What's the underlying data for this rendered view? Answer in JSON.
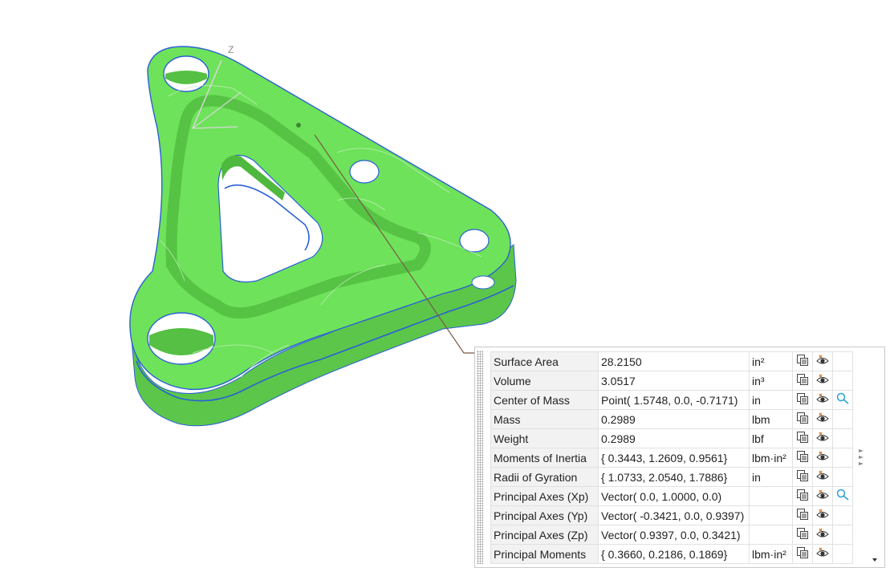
{
  "viewport": {
    "axis_label": "Z",
    "part_color": "#6ee25a",
    "edge_color": "#2a5fd6"
  },
  "properties": {
    "rows": [
      {
        "name": "Surface Area",
        "value": "28.2150",
        "unit": "in²",
        "expand": false
      },
      {
        "name": "Volume",
        "value": "3.0517",
        "unit": "in³",
        "expand": false
      },
      {
        "name": "Center of Mass",
        "value": "Point( 1.5748, 0.0, -0.7171)",
        "unit": "in",
        "expand": true
      },
      {
        "name": "Mass",
        "value": "0.2989",
        "unit": "lbm",
        "expand": false
      },
      {
        "name": "Weight",
        "value": "0.2989",
        "unit": "lbf",
        "expand": false
      },
      {
        "name": "Moments of Inertia",
        "value": "{ 0.3443, 1.2609, 0.9561}",
        "unit": "lbm·in²",
        "expand": false
      },
      {
        "name": "Radii of Gyration",
        "value": "{ 1.0733, 2.0540, 1.7886}",
        "unit": "in",
        "expand": false
      },
      {
        "name": "Principal Axes (Xp)",
        "value": "Vector( 0.0, 1.0000, 0.0)",
        "unit": "",
        "expand": true
      },
      {
        "name": "Principal Axes (Yp)",
        "value": "Vector( -0.3421, 0.0, 0.9397)",
        "unit": "",
        "expand": false
      },
      {
        "name": "Principal Axes (Zp)",
        "value": "Vector( 0.9397, 0.0, 0.3421)",
        "unit": "",
        "expand": false
      },
      {
        "name": "Principal Moments",
        "value": "{ 0.3660, 0.2186, 0.1869}",
        "unit": "lbm·in²",
        "expand": false
      }
    ],
    "icons": {
      "copy": "copy-to-clipboard-icon",
      "show": "show-in-view-icon",
      "expand": "expand-vector-icon"
    }
  }
}
